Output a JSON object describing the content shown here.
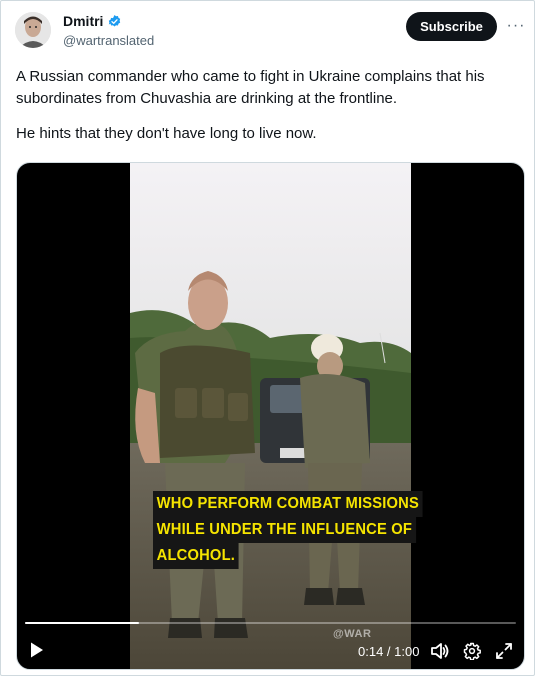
{
  "author": {
    "display_name": "Dmitri",
    "handle": "@wartranslated",
    "verified": true
  },
  "actions": {
    "subscribe_label": "Subscribe",
    "more_label": "···"
  },
  "tweet": {
    "paragraphs": [
      "A Russian commander who came to fight in Ukraine complains that his subordinates from Chuvashia are drinking at the frontline.",
      "He hints that they don't have long to live now."
    ]
  },
  "video": {
    "captions": [
      "WHO PERFORM COMBAT MISSIONS",
      "WHILE UNDER THE INFLUENCE OF",
      "ALCOHOL."
    ],
    "watermark": "@WAR",
    "time_display": "0:14 / 1:00",
    "progress": 0.233
  },
  "icons": {
    "verified": "verified-badge-icon",
    "play": "play-icon",
    "volume": "volume-icon",
    "settings": "gear-icon",
    "fullscreen": "fullscreen-icon"
  },
  "colors": {
    "accent_verified": "#1d9bf0",
    "button_bg": "#0f1419",
    "caption_text": "#f5e400",
    "caption_bg": "#161616"
  }
}
